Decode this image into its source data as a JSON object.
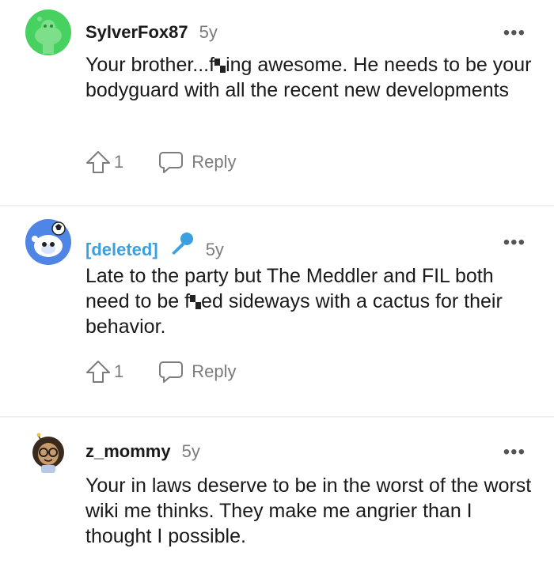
{
  "comments": [
    {
      "username": "SylverFox87",
      "age": "5y",
      "body_parts": [
        "Your brother...f",
        "ing awesome. He needs to be your bodyguard with all the recent new developments"
      ],
      "votes": "1",
      "reply_label": "Reply",
      "more_label": "•••"
    },
    {
      "username": "[deleted]",
      "age": "5y",
      "body_parts": [
        "Late to the party but The Meddler and FIL both need to be f",
        "ed sideways with a cactus for their behavior."
      ],
      "votes": "1",
      "reply_label": "Reply",
      "more_label": "•••"
    },
    {
      "username": "z_mommy",
      "age": "5y",
      "body": "Your in laws deserve to be in the worst of the worst wiki me thinks. They make me angrier than I thought I possible.",
      "more_label": "•••"
    }
  ],
  "colors": {
    "deleted_user": "#3aa0e0",
    "meta_gray": "#7c7c7c",
    "divider": "#edeff1",
    "avatar_green": "#46d160"
  },
  "icons": [
    "snoo-avatar-green",
    "snoo-avatar-blue",
    "user-avatar-character",
    "upvote-icon",
    "comment-icon",
    "microphone-icon",
    "more-icon"
  ]
}
